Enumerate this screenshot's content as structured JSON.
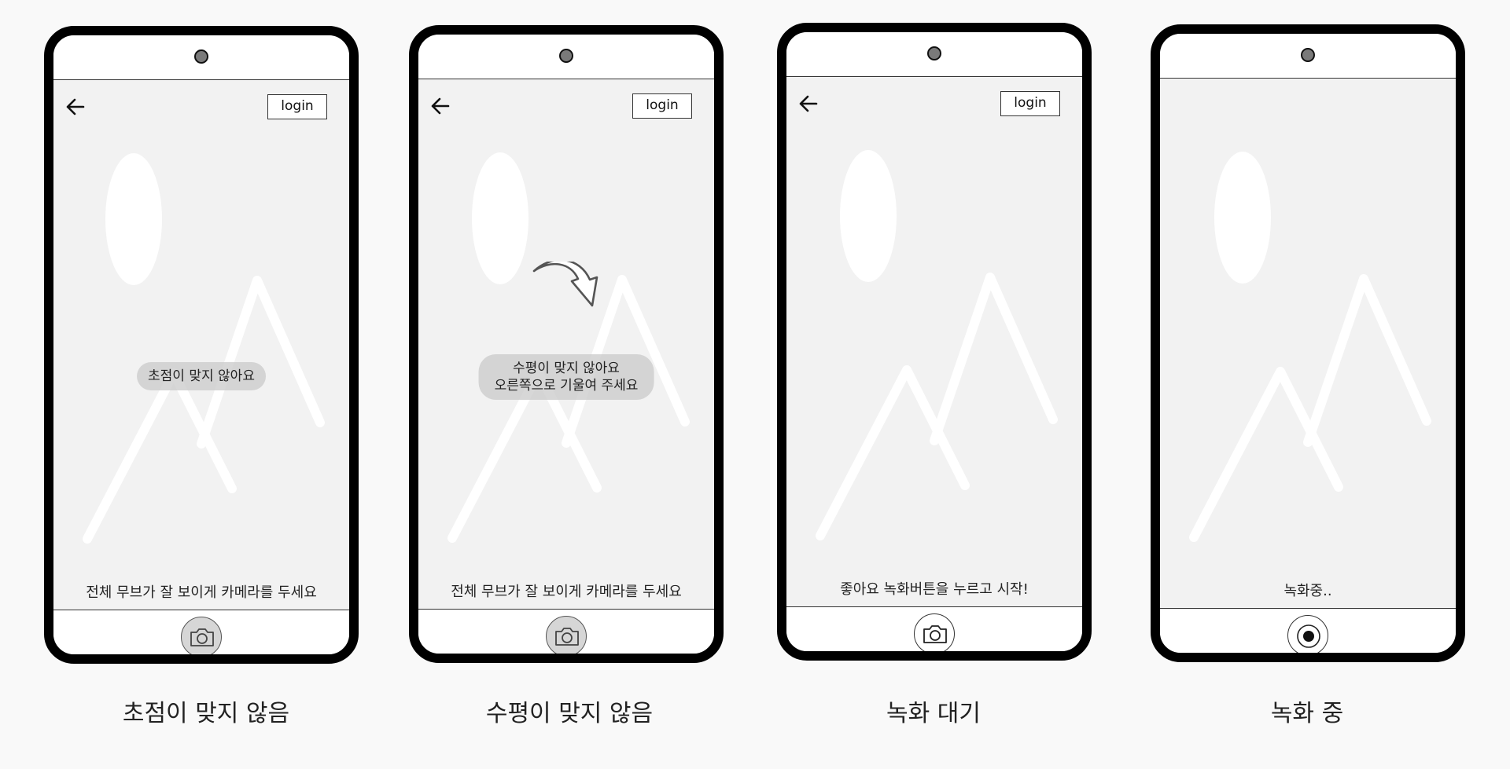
{
  "login_label": "login",
  "screens": [
    {
      "toast_lines": [
        "초점이 맞지 않아요"
      ],
      "guide": "전체 무브가 잘 보이게 카메라를 두세요",
      "shutter_state": "disabled",
      "shutter_icon": "camera-icon",
      "caption": "초점이 맞지 않음"
    },
    {
      "toast_lines": [
        "수평이 맞지 않아요",
        "오른쪽으로 기울여 주세요"
      ],
      "guide": "전체 무브가 잘 보이게 카메라를 두세요",
      "shutter_state": "disabled",
      "shutter_icon": "camera-icon",
      "caption": "수평이 맞지 않음"
    },
    {
      "guide": "좋아요 녹화버튼을 누르고 시작!",
      "shutter_state": "ready",
      "shutter_icon": "camera-icon",
      "caption": "녹화 대기"
    },
    {
      "guide": "녹화중..",
      "shutter_state": "recording",
      "shutter_icon": "record-icon",
      "caption": "녹화 중"
    }
  ]
}
